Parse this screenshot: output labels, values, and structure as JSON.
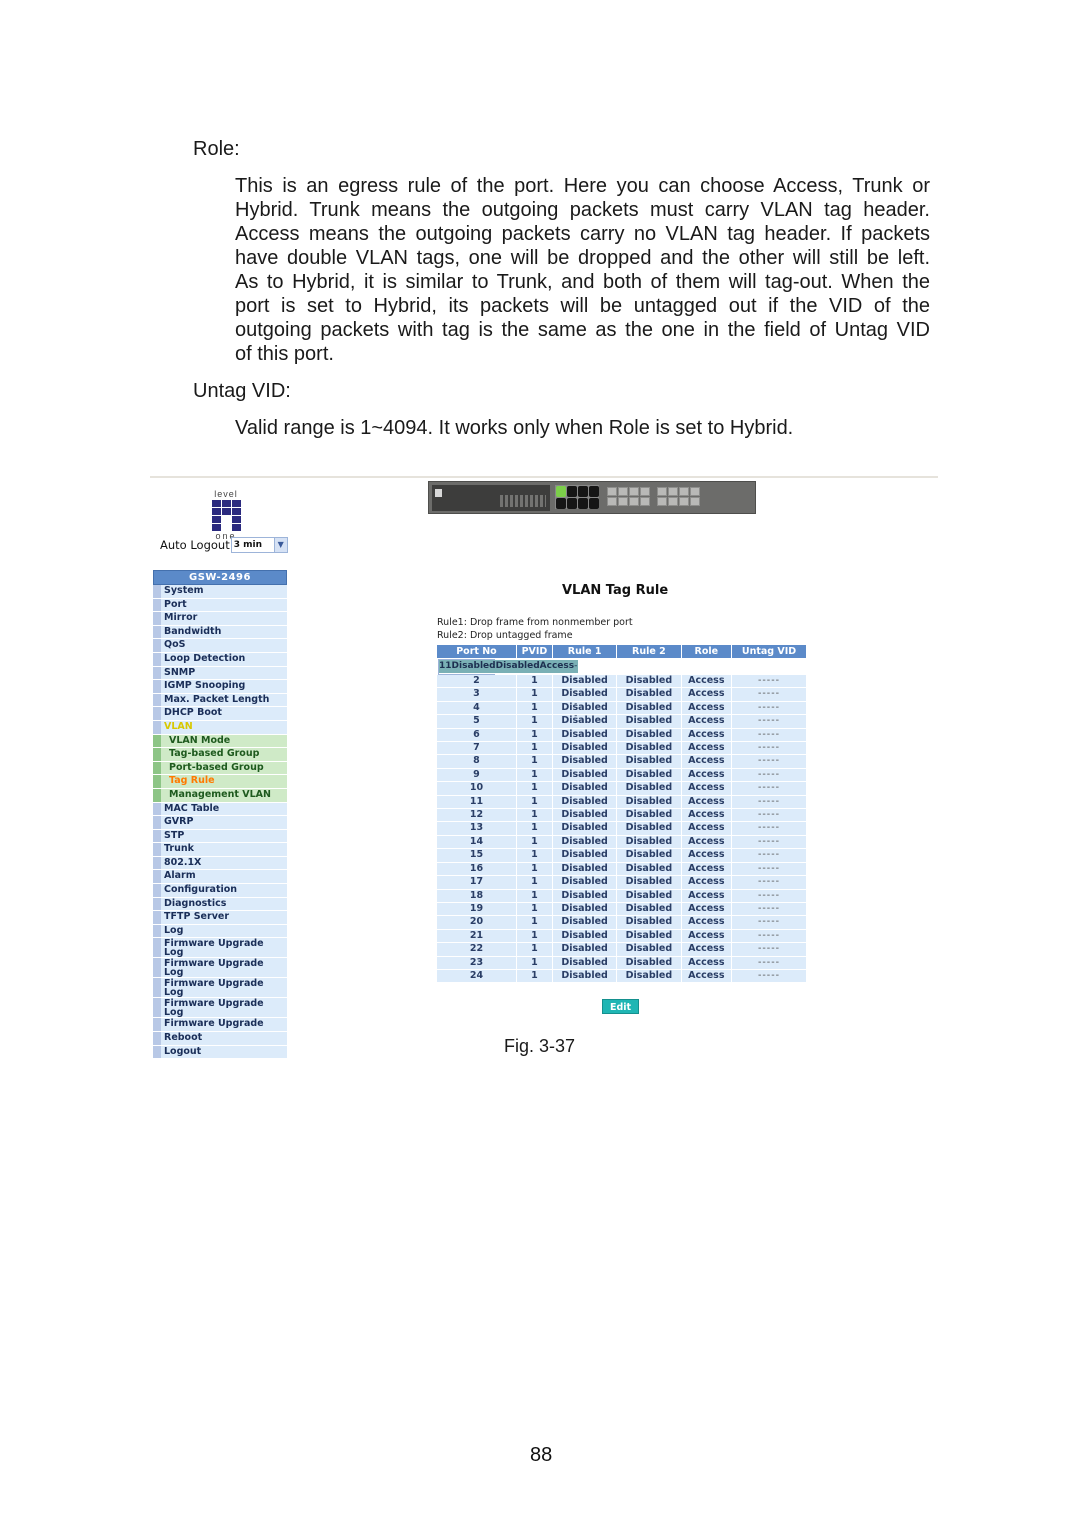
{
  "document": {
    "role_heading": "Role:",
    "role_paragraph_lines": [
      "This is an egress rule of the port. Here you can choose Access, Trunk or",
      "Hybrid. Trunk means the outgoing packets must carry VLAN tag header.",
      "Access means the outgoing packets carry no VLAN tag header. If packets",
      "have double VLAN tags, one will be dropped and the other will still be left.",
      "As to Hybrid, it is similar to Trunk, and both of them will tag-out. When the",
      "port is set to Hybrid, its packets will be untagged out if the VID of the",
      "outgoing packets with tag is the same as the one in the field of Untag VID",
      "of this port."
    ],
    "untag_heading": "Untag VID:",
    "untag_paragraph": "Valid range is 1~4094. It works only when Role is set to Hybrid.",
    "figure_caption": "Fig. 3-37",
    "page_number": "88"
  },
  "screenshot": {
    "logo": {
      "top_text": "level",
      "bottom_text": "one",
      "icon": "levelone-logo-icon"
    },
    "auto_logout": {
      "label": "Auto Logout",
      "value": "3 min",
      "arrow_icon": "chevron-down-icon"
    },
    "sidebar": {
      "title": "GSW-2496",
      "items": [
        {
          "label": "System",
          "type": "item"
        },
        {
          "label": "Port",
          "type": "item"
        },
        {
          "label": "Mirror",
          "type": "item"
        },
        {
          "label": "Bandwidth",
          "type": "item"
        },
        {
          "label": "QoS",
          "type": "item"
        },
        {
          "label": "Loop Detection",
          "type": "item"
        },
        {
          "label": "SNMP",
          "type": "item"
        },
        {
          "label": "IGMP Snooping",
          "type": "item"
        },
        {
          "label": "Max. Packet Length",
          "type": "item"
        },
        {
          "label": "DHCP Boot",
          "type": "item"
        },
        {
          "label": "VLAN",
          "type": "active-parent"
        },
        {
          "label": "VLAN Mode",
          "type": "sub"
        },
        {
          "label": "Tag-based Group",
          "type": "sub"
        },
        {
          "label": "Port-based Group",
          "type": "sub"
        },
        {
          "label": "Tag Rule",
          "type": "sub-active"
        },
        {
          "label": "Management VLAN",
          "type": "sub"
        },
        {
          "label": "MAC Table",
          "type": "item"
        },
        {
          "label": "GVRP",
          "type": "item"
        },
        {
          "label": "STP",
          "type": "item"
        },
        {
          "label": "Trunk",
          "type": "item"
        },
        {
          "label": "802.1X",
          "type": "item"
        },
        {
          "label": "Alarm",
          "type": "item"
        },
        {
          "label": "Configuration",
          "type": "item"
        },
        {
          "label": "Diagnostics",
          "type": "item"
        },
        {
          "label": "TFTP Server",
          "type": "item"
        },
        {
          "label": "Log",
          "type": "item"
        },
        {
          "label": "Firmware Upgrade\nLog",
          "type": "double"
        },
        {
          "label": "Firmware Upgrade\nLog",
          "type": "double"
        },
        {
          "label": "Firmware Upgrade\nLog",
          "type": "double"
        },
        {
          "label": "Firmware Upgrade\nLog",
          "type": "double"
        },
        {
          "label": "Firmware Upgrade",
          "type": "item"
        },
        {
          "label": "Reboot",
          "type": "item"
        },
        {
          "label": "Logout",
          "type": "item"
        }
      ]
    },
    "switch_image": {
      "icon": "switch-front-panel-icon",
      "active_port": 1
    },
    "page_title": "VLAN Tag Rule",
    "rule_notes": [
      "Rule1: Drop frame from nonmember port",
      "Rule2: Drop untagged frame"
    ],
    "table": {
      "columns": [
        "Port No",
        "PVID",
        "Rule 1",
        "Rule 2",
        "Role",
        "Untag VID"
      ],
      "selected_row": 0,
      "rows": [
        [
          "1",
          "1",
          "Disabled",
          "Disabled",
          "Access",
          "-----"
        ],
        [
          "2",
          "1",
          "Disabled",
          "Disabled",
          "Access",
          "-----"
        ],
        [
          "3",
          "1",
          "Disabled",
          "Disabled",
          "Access",
          "-----"
        ],
        [
          "4",
          "1",
          "Disabled",
          "Disabled",
          "Access",
          "-----"
        ],
        [
          "5",
          "1",
          "Disabled",
          "Disabled",
          "Access",
          "-----"
        ],
        [
          "6",
          "1",
          "Disabled",
          "Disabled",
          "Access",
          "-----"
        ],
        [
          "7",
          "1",
          "Disabled",
          "Disabled",
          "Access",
          "-----"
        ],
        [
          "8",
          "1",
          "Disabled",
          "Disabled",
          "Access",
          "-----"
        ],
        [
          "9",
          "1",
          "Disabled",
          "Disabled",
          "Access",
          "-----"
        ],
        [
          "10",
          "1",
          "Disabled",
          "Disabled",
          "Access",
          "-----"
        ],
        [
          "11",
          "1",
          "Disabled",
          "Disabled",
          "Access",
          "-----"
        ],
        [
          "12",
          "1",
          "Disabled",
          "Disabled",
          "Access",
          "-----"
        ],
        [
          "13",
          "1",
          "Disabled",
          "Disabled",
          "Access",
          "-----"
        ],
        [
          "14",
          "1",
          "Disabled",
          "Disabled",
          "Access",
          "-----"
        ],
        [
          "15",
          "1",
          "Disabled",
          "Disabled",
          "Access",
          "-----"
        ],
        [
          "16",
          "1",
          "Disabled",
          "Disabled",
          "Access",
          "-----"
        ],
        [
          "17",
          "1",
          "Disabled",
          "Disabled",
          "Access",
          "-----"
        ],
        [
          "18",
          "1",
          "Disabled",
          "Disabled",
          "Access",
          "-----"
        ],
        [
          "19",
          "1",
          "Disabled",
          "Disabled",
          "Access",
          "-----"
        ],
        [
          "20",
          "1",
          "Disabled",
          "Disabled",
          "Access",
          "-----"
        ],
        [
          "21",
          "1",
          "Disabled",
          "Disabled",
          "Access",
          "-----"
        ],
        [
          "22",
          "1",
          "Disabled",
          "Disabled",
          "Access",
          "-----"
        ],
        [
          "23",
          "1",
          "Disabled",
          "Disabled",
          "Access",
          "-----"
        ],
        [
          "24",
          "1",
          "Disabled",
          "Disabled",
          "Access",
          "-----"
        ]
      ]
    },
    "edit_button": "Edit",
    "colors": {
      "header_blue": "#5b8ac9",
      "row_bg": "#dcebfa",
      "selected_row": "#7ab0b5",
      "submenu_bg": "#cfeac7",
      "active_parent": "#d8c800",
      "active_item": "#ff7a00",
      "edit_button": "#1fb6b4"
    }
  }
}
